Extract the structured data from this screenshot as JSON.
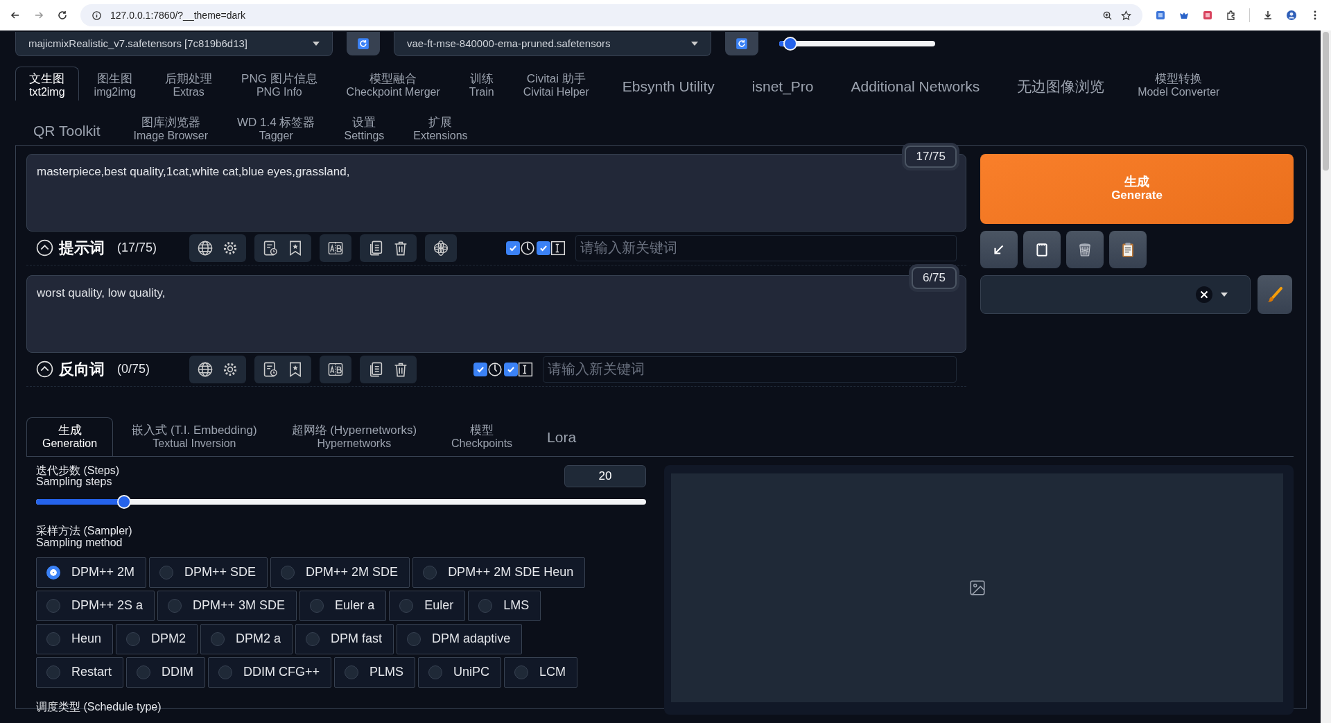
{
  "browser": {
    "url": "127.0.0.1:7860/?__theme=dark"
  },
  "top": {
    "checkpoint": "majicmixRealistic_v7.safetensors [7c819b6d13]",
    "vae": "vae-ft-mse-840000-ema-pruned.safetensors",
    "clip_skip": {
      "level": 0.03
    }
  },
  "tab_rows": [
    {
      "tabs": [
        {
          "label": "文生图",
          "sublabel": "txt2img",
          "selected": true
        },
        {
          "label": "图生图",
          "sublabel": "img2img",
          "selected": false
        },
        {
          "label": "后期处理",
          "sublabel": "Extras",
          "selected": false
        },
        {
          "label": "PNG 图片信息",
          "sublabel": "PNG Info",
          "selected": false
        },
        {
          "label": "模型融合",
          "sublabel": "Checkpoint Merger",
          "selected": false
        },
        {
          "label": "训练",
          "sublabel": "Train",
          "selected": false
        },
        {
          "label": "Civitai 助手",
          "sublabel": "Civitai Helper",
          "selected": false
        },
        {
          "label": "Ebsynth Utility",
          "selected": false
        },
        {
          "label": "isnet_Pro",
          "selected": false
        },
        {
          "label": "Additional Networks",
          "selected": false
        },
        {
          "label": "无边图像浏览",
          "selected": false
        },
        {
          "label": "模型转换",
          "sublabel": "Model Converter",
          "selected": false
        }
      ]
    },
    {
      "tabs": [
        {
          "label": "QR Toolkit",
          "selected": false
        },
        {
          "label": "图库浏览器",
          "sublabel": "Image Browser",
          "selected": false
        },
        {
          "label": "WD 1.4 标签器",
          "sublabel": "Tagger",
          "selected": false
        },
        {
          "label": "设置",
          "sublabel": "Settings",
          "selected": false
        },
        {
          "label": "扩展",
          "sublabel": "Extensions",
          "selected": false
        }
      ]
    }
  ],
  "prompts": [
    {
      "kind": "positive",
      "value": "masterpiece,best quality,1cat,white cat,blue eyes,grassland,",
      "token_count": "17/75",
      "title": "提示词",
      "count": "(17/75)",
      "options": [
        {
          "checked": true
        },
        {
          "checked": true
        }
      ],
      "placeholder": "请输入新关键词"
    },
    {
      "kind": "negative",
      "value": "worst quality, low quality,",
      "token_count": "6/75",
      "title": "反向词",
      "count": "(0/75)",
      "options": [
        {
          "checked": true
        },
        {
          "checked": true
        }
      ],
      "placeholder": "请输入新关键词"
    }
  ],
  "generate": {
    "label": "生成",
    "sublabel": "Generate"
  },
  "sub_tabs": [
    {
      "label": "生成",
      "sublabel": "Generation",
      "selected": true
    },
    {
      "label": "嵌入式 (T.I. Embedding)",
      "sublabel": "Textual Inversion",
      "selected": false
    },
    {
      "label": "超网络 (Hypernetworks)",
      "sublabel": "Hypernetworks",
      "selected": false
    },
    {
      "label": "模型",
      "sublabel": "Checkpoints",
      "selected": false
    },
    {
      "label": "Lora",
      "selected": false
    }
  ],
  "steps": {
    "label": "迭代步数 (Steps)",
    "sublabel": "Sampling steps",
    "value": "20",
    "level": 0.136
  },
  "sampler": {
    "label": "采样方法 (Sampler)",
    "sublabel": "Sampling method",
    "options": [
      {
        "label": "DPM++ 2M",
        "selected": true
      },
      {
        "label": "DPM++ SDE",
        "selected": false
      },
      {
        "label": "DPM++ 2M SDE",
        "selected": false
      },
      {
        "label": "DPM++ 2M SDE Heun",
        "selected": false
      },
      {
        "label": "DPM++ 2S a",
        "selected": false
      },
      {
        "label": "DPM++ 3M SDE",
        "selected": false
      },
      {
        "label": "Euler a",
        "selected": false
      },
      {
        "label": "Euler",
        "selected": false
      },
      {
        "label": "LMS",
        "selected": false
      },
      {
        "label": "Heun",
        "selected": false
      },
      {
        "label": "DPM2",
        "selected": false
      },
      {
        "label": "DPM2 a",
        "selected": false
      },
      {
        "label": "DPM fast",
        "selected": false
      },
      {
        "label": "DPM adaptive",
        "selected": false
      },
      {
        "label": "Restart",
        "selected": false
      },
      {
        "label": "DDIM",
        "selected": false
      },
      {
        "label": "DDIM CFG++",
        "selected": false
      },
      {
        "label": "PLMS",
        "selected": false
      },
      {
        "label": "UniPC",
        "selected": false
      },
      {
        "label": "LCM",
        "selected": false
      }
    ]
  },
  "schedule": {
    "label": "调度类型 (Schedule type)"
  }
}
